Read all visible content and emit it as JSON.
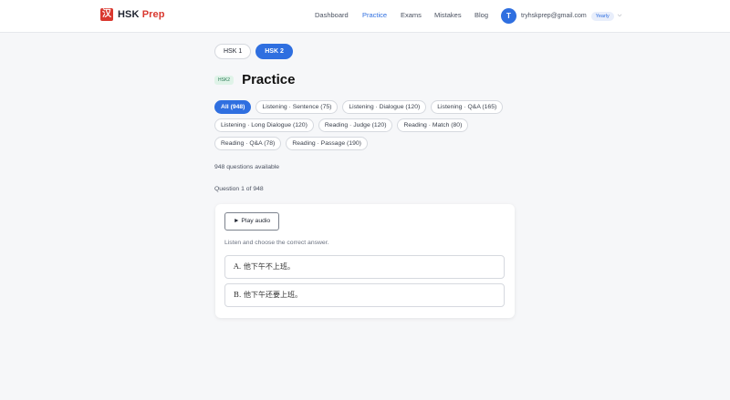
{
  "brand": {
    "name": "HSK",
    "accent": "Prep",
    "mark": "汉"
  },
  "nav": {
    "items": [
      {
        "label": "Dashboard",
        "active": false
      },
      {
        "label": "Practice",
        "active": true
      },
      {
        "label": "Exams",
        "active": false
      },
      {
        "label": "Mistakes",
        "active": false
      },
      {
        "label": "Blog",
        "active": false
      }
    ]
  },
  "user": {
    "initial": "T",
    "email": "tryhskprep@gmail.com",
    "plan": "Yearly"
  },
  "level_tabs": [
    {
      "label": "HSK 1",
      "active": false
    },
    {
      "label": "HSK 2",
      "active": true
    }
  ],
  "page": {
    "level_badge": "HSK2",
    "title": "Practice"
  },
  "filters": [
    {
      "label": "All (948)",
      "active": true
    },
    {
      "label": "Listening · Sentence (75)",
      "active": false
    },
    {
      "label": "Listening · Dialogue (120)",
      "active": false
    },
    {
      "label": "Listening · Q&A (165)",
      "active": false
    },
    {
      "label": "Listening · Long Dialogue (120)",
      "active": false
    },
    {
      "label": "Reading · Judge (120)",
      "active": false
    },
    {
      "label": "Reading · Match (80)",
      "active": false
    },
    {
      "label": "Reading · Q&A (78)",
      "active": false
    },
    {
      "label": "Reading · Passage (190)",
      "active": false
    }
  ],
  "status": {
    "available": "948 questions available",
    "position": "Question 1 of 948"
  },
  "question": {
    "play_label": "► Play audio",
    "instruction": "Listen and choose the correct answer.",
    "options": [
      "A. 他下午不上班。",
      "B. 他下午还要上班。"
    ]
  },
  "colors": {
    "primary": "#2f6fe0",
    "brand_red": "#d9382f",
    "badge_green": "#dff3e8"
  }
}
